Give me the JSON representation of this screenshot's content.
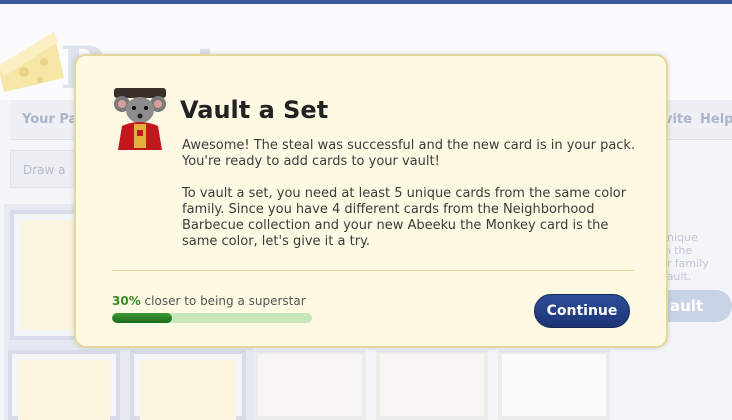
{
  "app": {
    "logo_text": "Ro..t",
    "nav": {
      "left_label": "Your Pac",
      "invite_label": "vite",
      "help_label": "Help"
    },
    "subnav": {
      "label": "Draw a"
    },
    "side_panel": {
      "lines": [
        "t",
        "unique",
        "m the",
        "or family",
        "Vault."
      ],
      "vault_button_label": "ault"
    }
  },
  "modal": {
    "title": "Vault a Set",
    "paragraph_1": "Awesome! The steal was successful and the new card is in your pack. You're ready to add cards to your vault!",
    "paragraph_2": "To vault a set, you need at least 5 unique cards from the same color family. Since you have 4 different cards from the Neighborhood Barbecue collection and your new Abeeku the Monkey card is the same color, let's give it a try.",
    "progress": {
      "percent_label": "30%",
      "text": " closer to being a superstar",
      "value": 0.3
    },
    "continue_label": "Continue"
  },
  "colors": {
    "accent": "#1c3476",
    "progress": "#3a9a35",
    "modal_bg": "#fdf9e3"
  }
}
